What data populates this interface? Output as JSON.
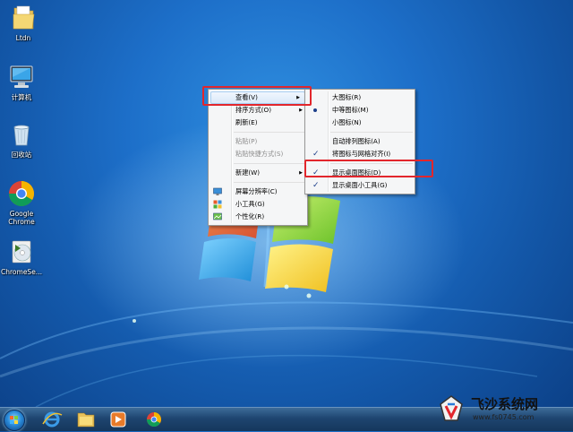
{
  "desktop_icons": [
    {
      "label": "Ltdn",
      "icon": "folder-icon"
    },
    {
      "label": "计算机",
      "icon": "computer-icon"
    },
    {
      "label": "回收站",
      "icon": "recycle-bin-icon"
    },
    {
      "label": "Google Chrome",
      "icon": "chrome-icon"
    },
    {
      "label": "ChromeSe...",
      "icon": "installer-disc-icon"
    }
  ],
  "context_menu": {
    "items": [
      {
        "label": "查看(V)",
        "submenu": true,
        "highlighted": true
      },
      {
        "label": "排序方式(O)",
        "submenu": true
      },
      {
        "label": "刷新(E)"
      },
      {
        "label": "粘贴(P)",
        "disabled": true
      },
      {
        "label": "粘贴快捷方式(S)",
        "disabled": true
      },
      {
        "label": "新建(W)",
        "submenu": true
      },
      {
        "label": "屏幕分辨率(C)",
        "icon": "display-icon"
      },
      {
        "label": "小工具(G)",
        "icon": "gadgets-icon"
      },
      {
        "label": "个性化(R)",
        "icon": "personalize-icon"
      }
    ]
  },
  "view_submenu": {
    "items": [
      {
        "label": "大图标(R)"
      },
      {
        "label": "中等图标(M)",
        "selected": true
      },
      {
        "label": "小图标(N)"
      },
      {
        "label": "自动排列图标(A)"
      },
      {
        "label": "将图标与网格对齐(I)",
        "checked": true
      },
      {
        "label": "显示桌面图标(D)",
        "checked": true
      },
      {
        "label": "显示桌面小工具(G)",
        "checked": true
      }
    ]
  },
  "taskbar": {
    "pinned": [
      "start-orb",
      "ie-icon",
      "explorer-icon",
      "media-player-icon",
      "chrome-icon"
    ]
  },
  "watermark": {
    "title": "飞沙系统网",
    "url": "www.fs0745.com"
  },
  "colors": {
    "highlight_box": "#e2262c",
    "desktop_blue": "#1d6fc9",
    "menu_bg": "#f5f6f7"
  }
}
